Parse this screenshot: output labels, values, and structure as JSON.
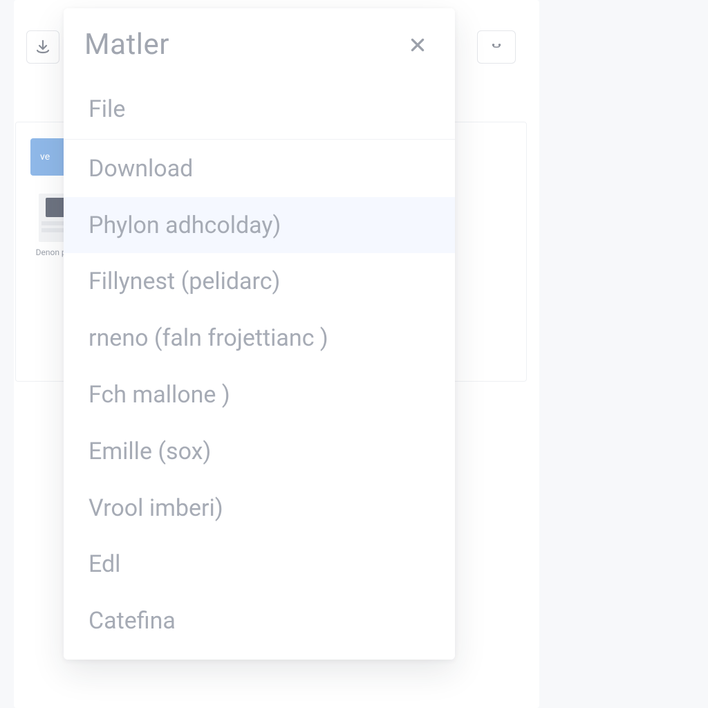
{
  "background": {
    "blue_pill_label": "ve",
    "thumb_caption": "Denon prot"
  },
  "modal": {
    "title": "Matler",
    "items": [
      "File",
      "Download",
      "Phylon adhcolday)",
      "Fillynest (pelidarc)",
      "rneno (faln frojettianc )",
      "Fch mallone )",
      "Emille (sox)",
      "Vrool imberi)",
      "Edl",
      "Catefina"
    ],
    "highlight_index": 2
  }
}
